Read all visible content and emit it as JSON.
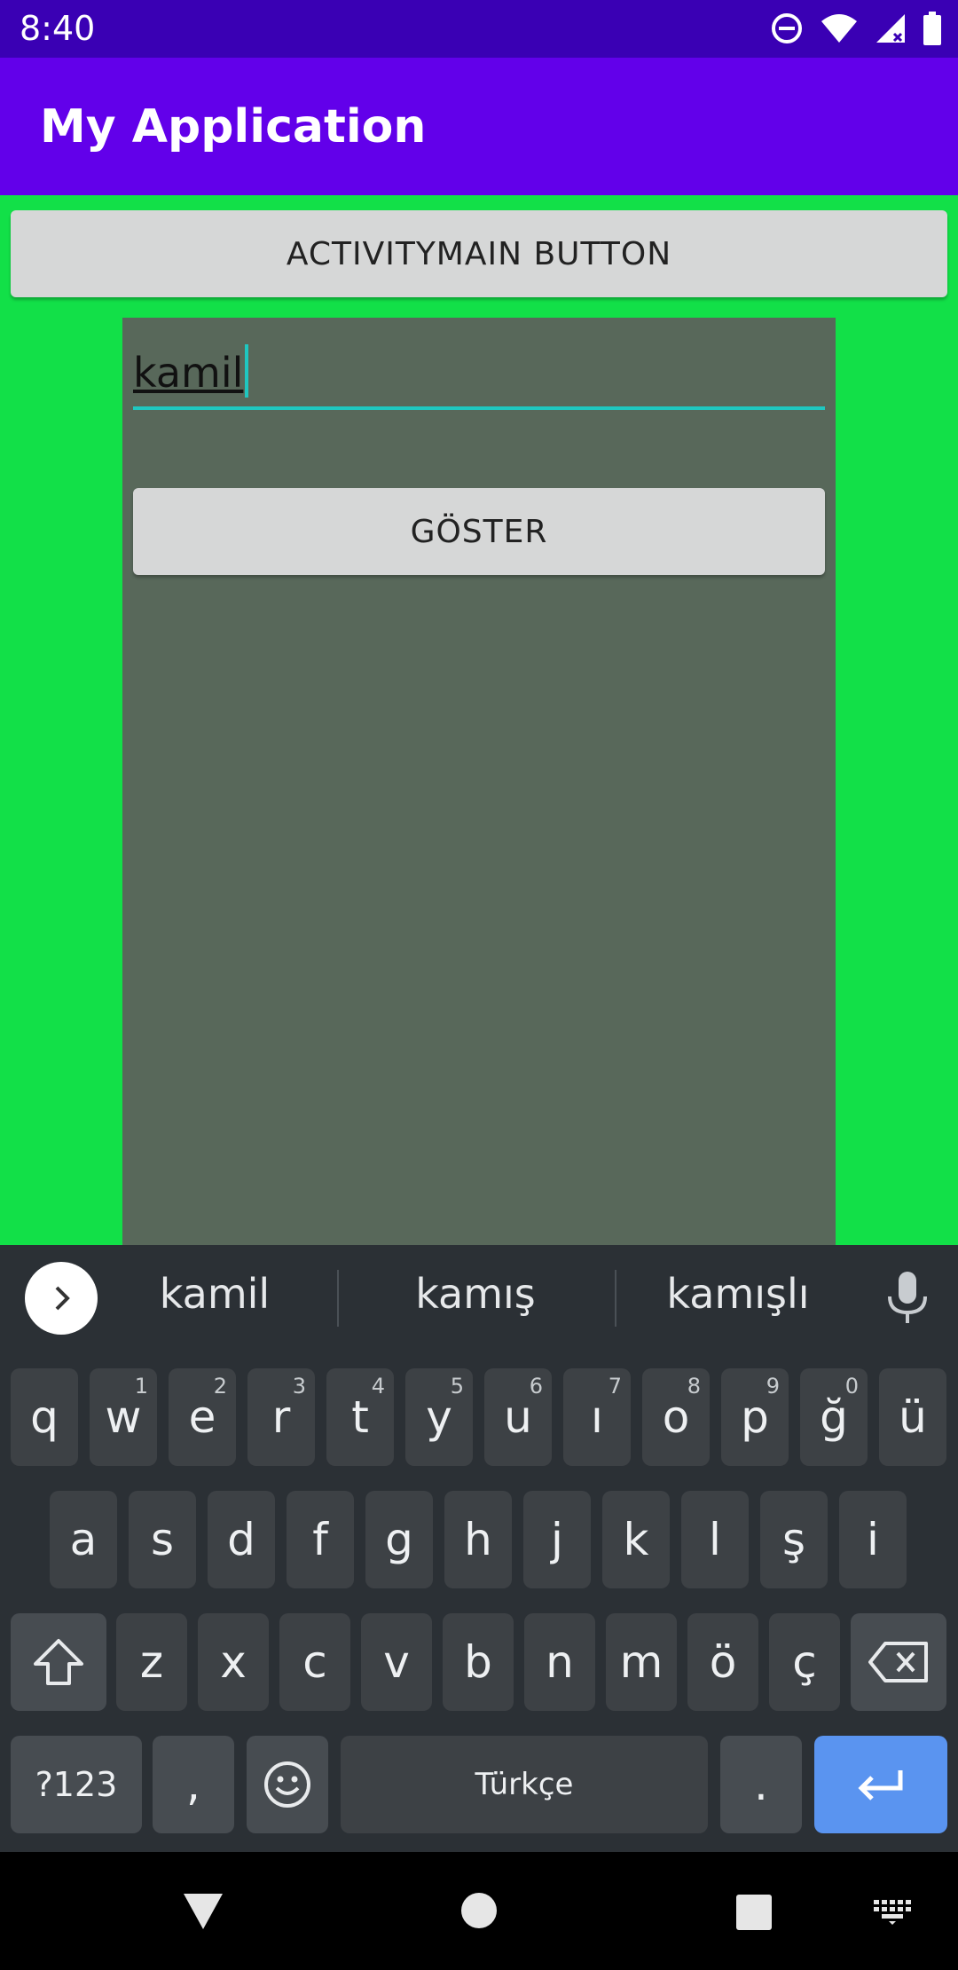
{
  "status": {
    "time": "8:40"
  },
  "app": {
    "title": "My Application"
  },
  "buttons": {
    "activitymain": "ACTIVITYMAIN BUTTON",
    "goster": "GÖSTER"
  },
  "input": {
    "value": "kamil"
  },
  "keyboard": {
    "suggestions": [
      "kamil",
      "kamış",
      "kamışlı"
    ],
    "row1": [
      "q",
      "w",
      "e",
      "r",
      "t",
      "y",
      "u",
      "ı",
      "o",
      "p",
      "ğ",
      "ü"
    ],
    "row1_hints": [
      "",
      "1",
      "2",
      "3",
      "4",
      "5",
      "6",
      "7",
      "8",
      "9",
      "0",
      ""
    ],
    "row2": [
      "a",
      "s",
      "d",
      "f",
      "g",
      "h",
      "j",
      "k",
      "l",
      "ş",
      "i"
    ],
    "row3": [
      "z",
      "x",
      "c",
      "v",
      "b",
      "n",
      "m",
      "ö",
      "ç"
    ],
    "sym_label": "?123",
    "comma": ",",
    "space_label": "Türkçe",
    "period": "."
  },
  "icons": {
    "status": [
      "do-not-disturb-icon",
      "wifi-icon",
      "signal-icon",
      "battery-icon"
    ],
    "keyboard": [
      "expand-icon",
      "mic-icon",
      "shift-icon",
      "backspace-icon",
      "emoji-icon",
      "enter-icon"
    ],
    "nav": [
      "back-icon",
      "home-icon",
      "recents-icon",
      "keyboard-switch-icon"
    ]
  }
}
